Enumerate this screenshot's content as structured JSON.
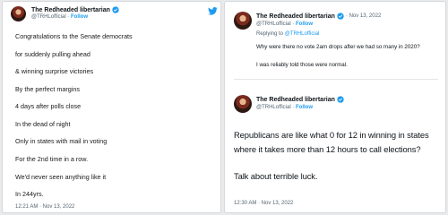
{
  "colors": {
    "accent": "#1d9bf0",
    "text": "#0f1419",
    "muted": "#536471",
    "background": "#e9eaec"
  },
  "left": {
    "author_name": "The Redheaded libertarian",
    "handle": "@TRHLofficial",
    "separator": "·",
    "follow_label": "Follow",
    "lines": [
      "Congratulations to the Senate democrats",
      "for suddenly pulling ahead",
      "& winning surprise victories",
      "By the perfect margins",
      "4 days after polls close",
      "In the dead of night",
      "Only in states with mail in voting",
      "For the 2nd time in a row.",
      "We'd never seen anything like it",
      "In 244yrs."
    ],
    "timestamp": "12:21 AM · Nov 13, 2022"
  },
  "right": {
    "tweet1": {
      "author_name": "The Redheaded libertarian",
      "date": "· Nov 13, 2022",
      "handle": "@TRHLofficial",
      "separator": "·",
      "follow_label": "Follow",
      "replying_prefix": "Replying to",
      "replying_handle": "@TRHLofficial",
      "line1": "Why were there no vote 2am drops after we had so many in 2020?",
      "line2": "I was reliably told those were normal."
    },
    "tweet2": {
      "author_name": "The Redheaded libertarian",
      "handle": "@TRHLofficial",
      "separator": "·",
      "follow_label": "Follow",
      "lines": [
        "Republicans are like what 0 for 12 in winning in states",
        "where it takes more than 12 hours to call elections?"
      ],
      "line3": "Talk about terrible luck.",
      "timestamp": "12:30 AM · Nov 13, 2022"
    }
  }
}
